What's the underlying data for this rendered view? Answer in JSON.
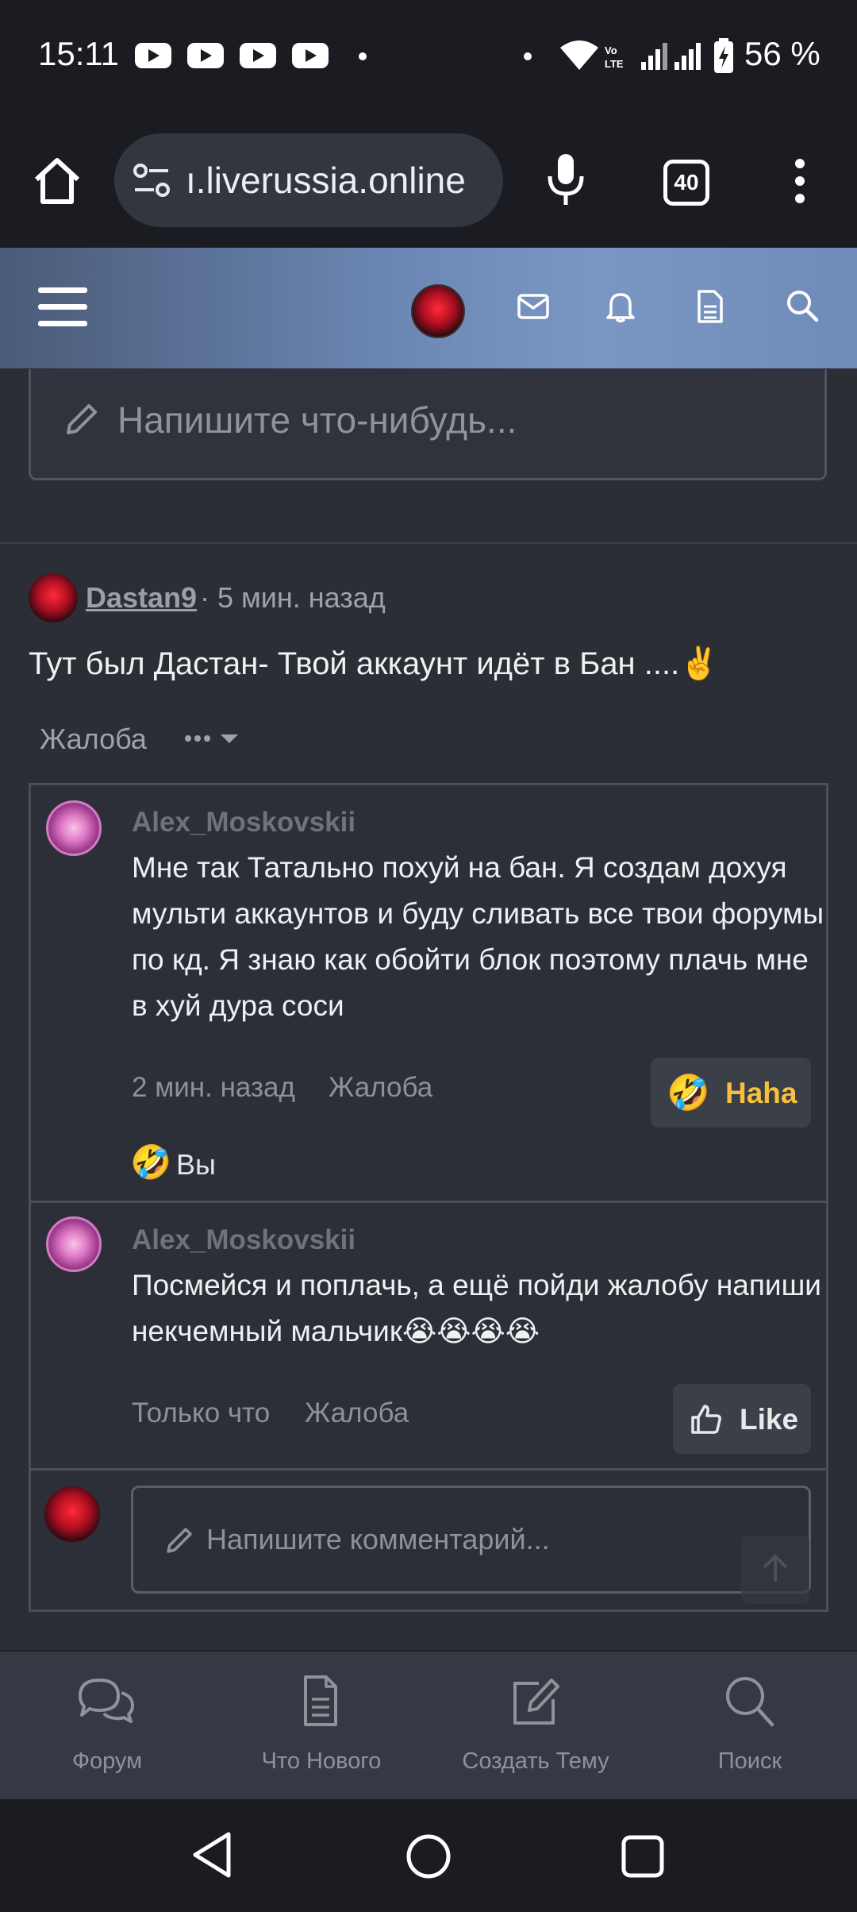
{
  "status_bar": {
    "time": "15:11",
    "battery": "56 %",
    "icons": [
      "youtube-icon",
      "youtube-icon",
      "youtube-icon",
      "youtube-icon",
      "dot-icon",
      "dot-icon",
      "wifi-icon",
      "volte-icon",
      "signal-icon",
      "signal-icon",
      "battery-charging-icon"
    ]
  },
  "browser": {
    "url": "ı.liverussia.online",
    "tab_count": "40",
    "icons": [
      "home-icon",
      "site-settings-icon",
      "microphone-icon",
      "tab-switcher-icon",
      "more-vert-icon"
    ]
  },
  "forum_header": {
    "icons": [
      "menu-icon",
      "avatar",
      "mail-icon",
      "bell-icon",
      "document-icon",
      "search-icon"
    ]
  },
  "compose": {
    "placeholder": "Напишите что-нибудь..."
  },
  "post": {
    "author": "Dastan9",
    "time": "· 5 мин. назад",
    "body": "Тут был Дастан- Твой аккаунт идёт в Бан ....✌️",
    "report": "Жалоба"
  },
  "comments": [
    {
      "author": "Alex_Moskovskii",
      "text": "Мне так Татально похуй на бан. Я создам дохуя мульти аккаунтов и буду сливать все твои форумы по кд. Я знаю как обойти блок поэтому плачь мне в хуй дура соси",
      "time": "2 мин. назад",
      "report": "Жалоба",
      "reaction_label": "Haha",
      "reaction_emoji": "🤣",
      "reacted_by": "Вы"
    },
    {
      "author": "Alex_Moskovskii",
      "text": "Посмейся и поплачь, а ещё пойди жалобу напиши некчемный мальчик😭😭😭😭",
      "time": "Только что",
      "report": "Жалоба",
      "reaction_label": "Like"
    }
  ],
  "comment_input": {
    "placeholder": "Напишите комментарий..."
  },
  "bottom_nav": [
    {
      "label": "Форум",
      "icon": "chat-icon"
    },
    {
      "label": "Что Нового",
      "icon": "document-icon"
    },
    {
      "label": "Создать Тему",
      "icon": "edit-icon"
    },
    {
      "label": "Поиск",
      "icon": "search-icon"
    }
  ],
  "colors": {
    "background": "#2b2e35",
    "header_gradient_start": "#4a5b78",
    "header_gradient_end": "#7a97c3",
    "haha_accent": "#f7c13a",
    "muted_text": "#8d9299"
  }
}
